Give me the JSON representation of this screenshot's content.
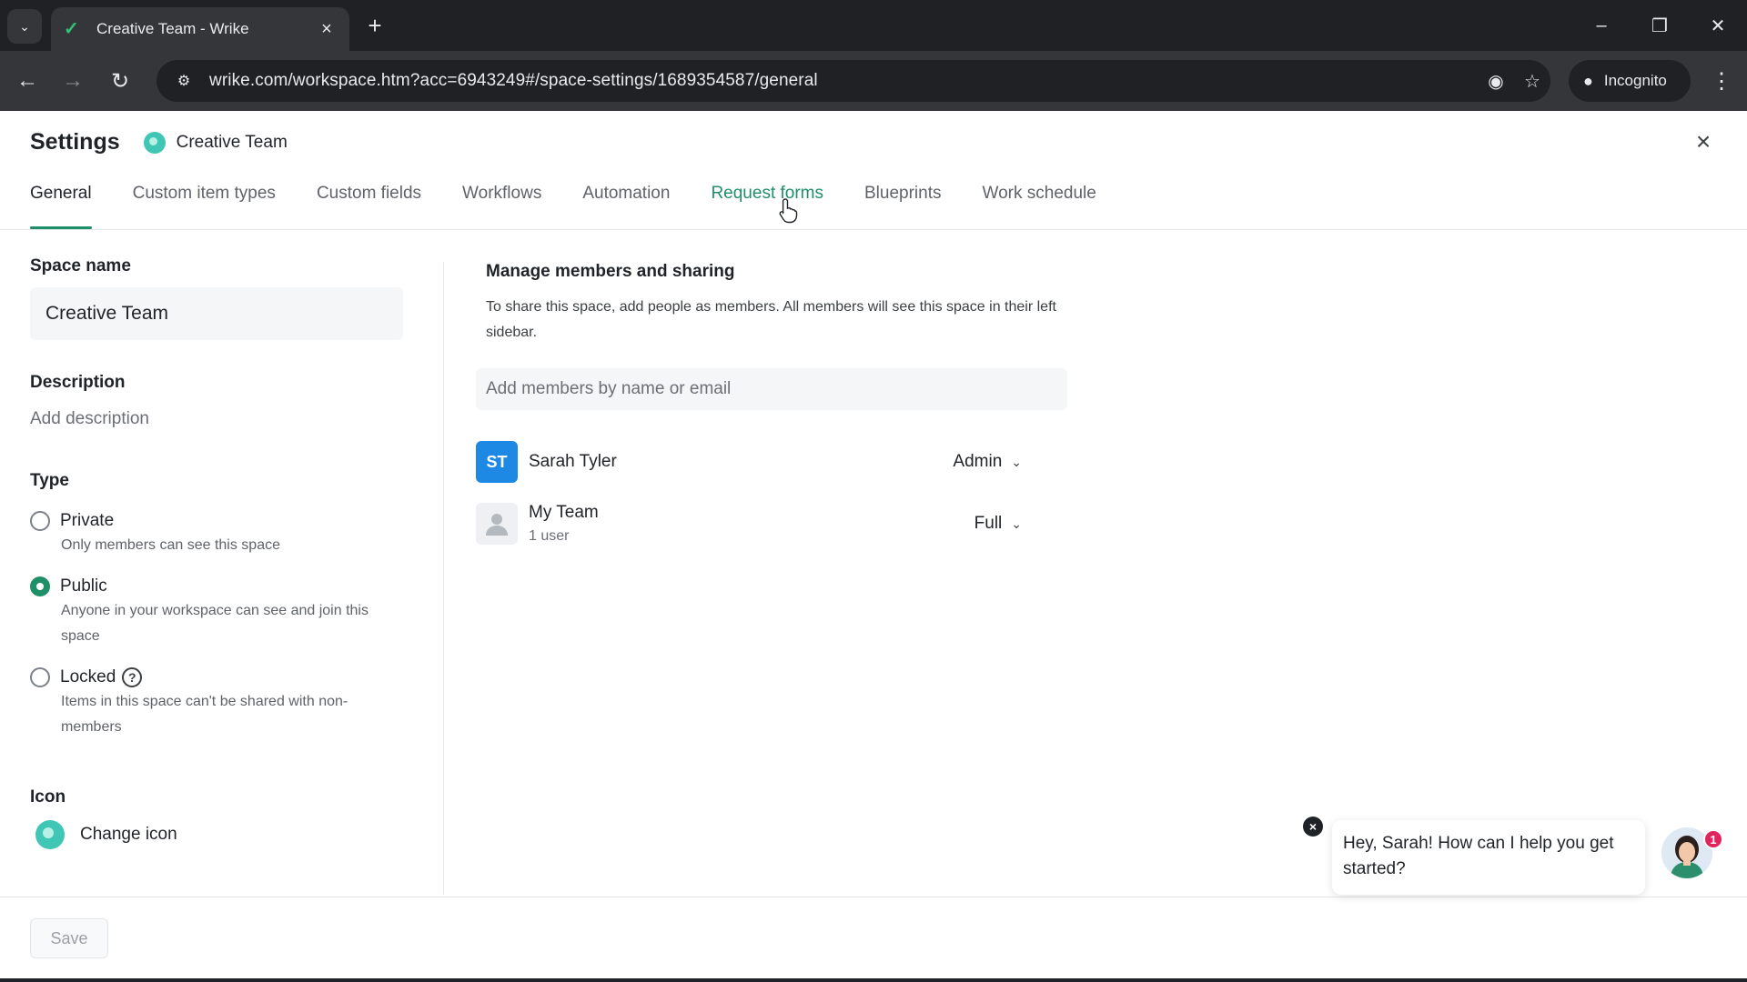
{
  "browser": {
    "tab_title": "Creative Team - Wrike",
    "url": "wrike.com/workspace.htm?acc=6943249#/space-settings/1689354587/general",
    "incognito_label": "Incognito"
  },
  "header": {
    "title": "Settings",
    "space_name": "Creative Team"
  },
  "tabs": [
    {
      "label": "General",
      "active": true
    },
    {
      "label": "Custom item types"
    },
    {
      "label": "Custom fields"
    },
    {
      "label": "Workflows"
    },
    {
      "label": "Automation"
    },
    {
      "label": "Request forms",
      "hover": true
    },
    {
      "label": "Blueprints"
    },
    {
      "label": "Work schedule"
    }
  ],
  "general": {
    "space_name_label": "Space name",
    "space_name_value": "Creative Team",
    "description_label": "Description",
    "description_placeholder": "Add description",
    "type_label": "Type",
    "types": [
      {
        "label": "Private",
        "desc": "Only members can see this space",
        "checked": false
      },
      {
        "label": "Public",
        "desc": "Anyone in your workspace can see and join this space",
        "checked": true
      },
      {
        "label": "Locked",
        "desc": "Items in this space can't be shared with non-members",
        "checked": false
      }
    ],
    "icon_label": "Icon",
    "change_icon_label": "Change icon"
  },
  "sharing": {
    "title": "Manage members and sharing",
    "description": "To share this space, add people as members. All members will see this space in their left sidebar.",
    "input_placeholder": "Add members by name or email",
    "members": [
      {
        "initials": "ST",
        "name": "Sarah Tyler",
        "sub": "",
        "role": "Admin"
      },
      {
        "initials": "",
        "name": "My Team",
        "sub": "1 user",
        "role": "Full"
      }
    ]
  },
  "footer": {
    "save_label": "Save"
  },
  "chat": {
    "message": "Hey, Sarah! How can I help you get started?",
    "badge_count": "1"
  },
  "colors": {
    "accent": "#1f8f68",
    "avatar_blue": "#1e88e5",
    "badge": "#e0245e"
  }
}
